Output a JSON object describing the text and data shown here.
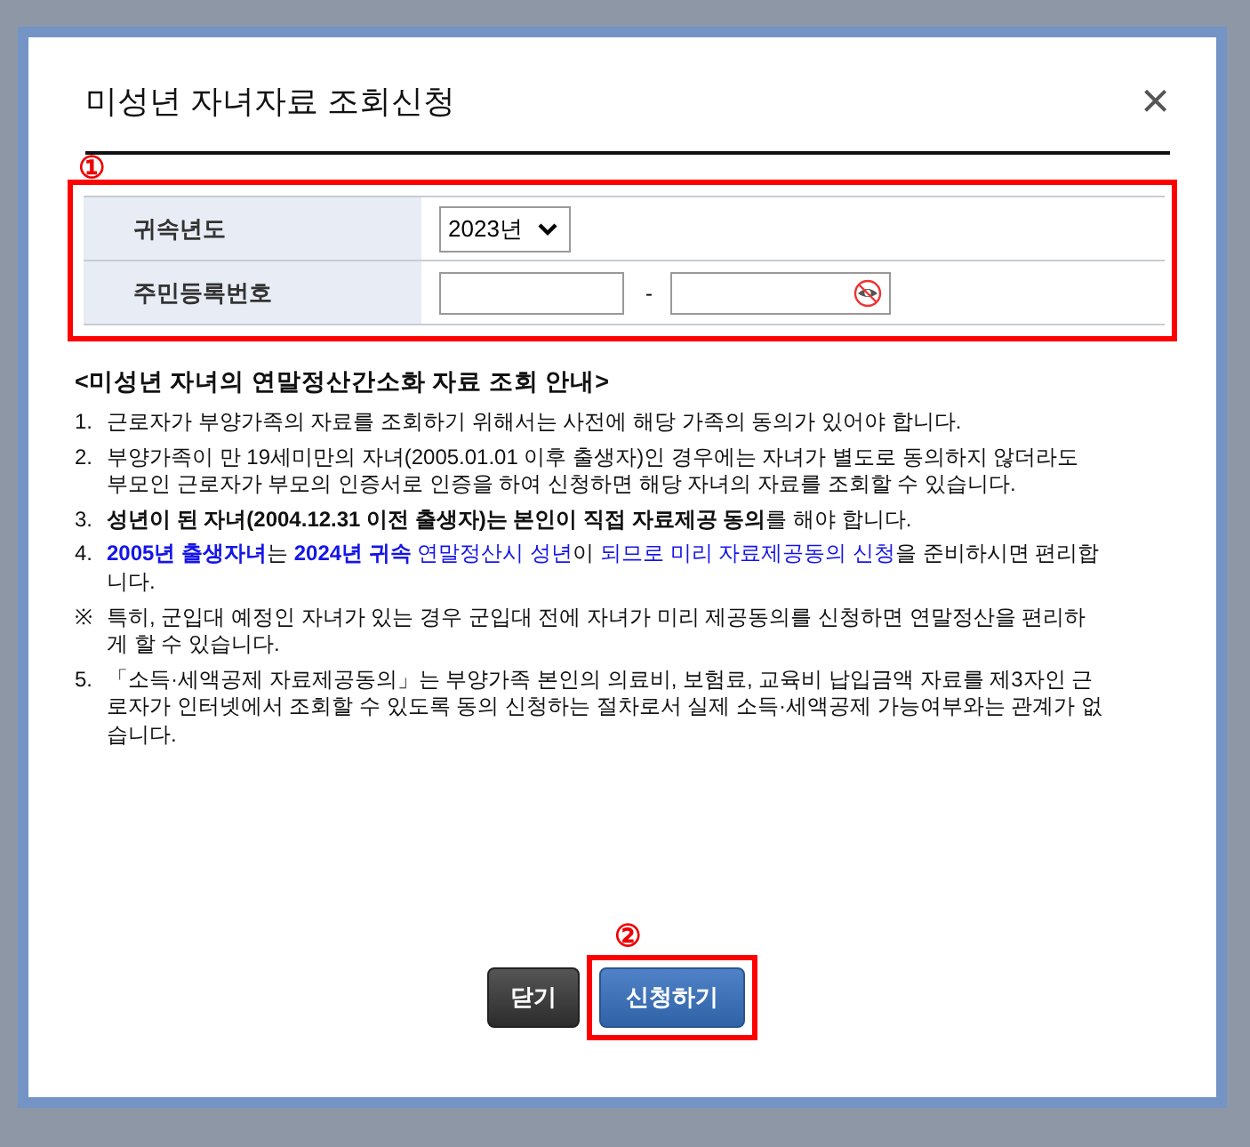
{
  "dialog": {
    "title": "미성년 자녀자료 조회신청",
    "close": "×"
  },
  "annotations": [
    {
      "label": "①"
    },
    {
      "label": "②"
    }
  ],
  "form": {
    "year_label": "귀속년도",
    "year_value": "2023년",
    "id_label": "주민등록번호",
    "separator": "-"
  },
  "notice": {
    "heading": "<미성년 자녀의 연말정산간소화 자료 조회 안내>",
    "items": [
      {
        "kind": "text",
        "marker": "1.",
        "text": "근로자가 부양가족의 자료를 조회하기 위해서는 사전에 해당 가족의 동의가 있어야 합니다."
      },
      {
        "kind": "text",
        "marker": "2.",
        "text": "부양가족이 만 19세미만의 자녀(2005.01.01 이후 출생자)인 경우에는 자녀가 별도로 동의하지 않더라도 부모인 근로자가 부모의 인증서로 인증을 하여 신청하면 해당 자녀의 자료를 조회할 수 있습니다."
      },
      {
        "kind": "text",
        "marker": "3.",
        "text": "**성년이 된 자녀(2004.12.31 이전 출생자)는 본인이 직접 자료제공 동의**를 해야 합니다."
      },
      {
        "kind": "segments",
        "marker": "4.",
        "segments": [
          {
            "text": "2005년 출생자녀",
            "color": "#1515e8",
            "bold": true
          },
          {
            "text": "는 ",
            "color": "#111111",
            "bold": false
          },
          {
            "text": "2024년 귀속",
            "color": "#1515e8",
            "bold": true
          },
          {
            "text": " 연말정산시 성년",
            "color": "#1515e8",
            "bold": false
          },
          {
            "text": "이 ",
            "color": "#111111",
            "bold": false
          },
          {
            "text": "되므로 미리 자료제공동의 신청",
            "color": "#1515e8",
            "bold": false
          },
          {
            "text": "을 준비하시면 편리합니다.",
            "color": "#111111",
            "bold": false
          }
        ]
      },
      {
        "kind": "text",
        "marker": "※",
        "text": "특히, 군입대 예정인 자녀가 있는 경우 군입대 전에 자녀가 미리 제공동의를 신청하면 연말정산을 편리하게 할 수 있습니다."
      },
      {
        "kind": "text",
        "marker": "5.",
        "text": "「소득·세액공제 자료제공동의」는 부양가족 본인의 의료비, 보험료, 교육비 납입금액 자료를 제3자인 근로자가 인터넷에서 조회할 수 있도록 동의 신청하는 절차로서 실제 소득·세액공제 가능여부와는 관계가 없습니다."
      }
    ]
  },
  "buttons": [
    {
      "label": "닫기",
      "kind": "close"
    },
    {
      "label": "신청하기",
      "kind": "submit"
    }
  ]
}
